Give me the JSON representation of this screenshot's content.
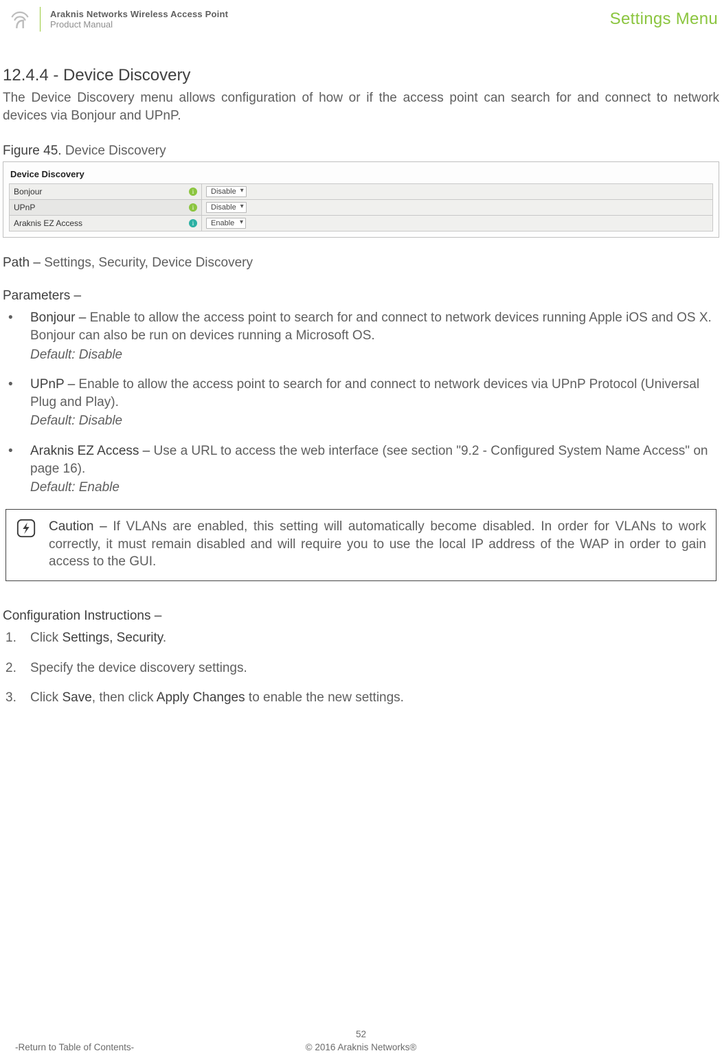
{
  "header": {
    "product_line1": "Araknis Networks Wireless Access Point",
    "product_line2": "Product Manual",
    "menu_label": "Settings Menu"
  },
  "section": {
    "number_title": "12.4.4 - Device Discovery",
    "intro": "The Device Discovery menu allows configuration of how or if the access point can search for and connect to network devices via Bonjour and UPnP."
  },
  "figure": {
    "label_bold": "Figure 45.",
    "label_rest": " Device Discovery",
    "panel_title": "Device Discovery",
    "rows": [
      {
        "name": "Bonjour",
        "value": "Disable"
      },
      {
        "name": "UPnP",
        "value": "Disable"
      },
      {
        "name": "Araknis EZ Access",
        "value": "Enable"
      }
    ]
  },
  "path": {
    "label": "Path – ",
    "value": "Settings, Security, Device Discovery"
  },
  "parameters": {
    "heading": "Parameters –",
    "items": [
      {
        "name": "Bonjour – ",
        "desc": "Enable to allow the access point to search for and connect to network devices running Apple iOS and OS X. Bonjour can also be run on devices running a Microsoft OS.",
        "default": "Default: Disable"
      },
      {
        "name": "UPnP – ",
        "desc": "Enable to allow the access point to search for and connect to network devices via UPnP Protocol (Universal Plug and Play).",
        "default": "Default: Disable"
      },
      {
        "name": "Araknis EZ Access – ",
        "desc": "Use a URL to access the web interface (see section \"9.2 - Configured System Name Access\" on page 16).",
        "default": "Default: Enable"
      }
    ]
  },
  "caution": {
    "lead": "Caution – ",
    "body": "If VLANs are enabled, this setting will automatically become disabled. In order for VLANs to work correctly, it must remain disabled and will require you to use the local IP address of the WAP in order to gain access to the GUI."
  },
  "config": {
    "heading": "Configuration Instructions –",
    "steps": [
      {
        "pre": "Click ",
        "b1": "Settings, Security",
        "post": "."
      },
      {
        "pre": "Specify the device discovery settings.",
        "b1": "",
        "post": ""
      },
      {
        "pre": "Click ",
        "b1": "Save",
        "mid": ", then click ",
        "b2": "Apply Changes",
        "post": " to enable the new settings."
      }
    ]
  },
  "footer": {
    "page": "52",
    "copyright": "© 2016 Araknis Networks®",
    "toc": "-Return to Table of Contents-"
  }
}
